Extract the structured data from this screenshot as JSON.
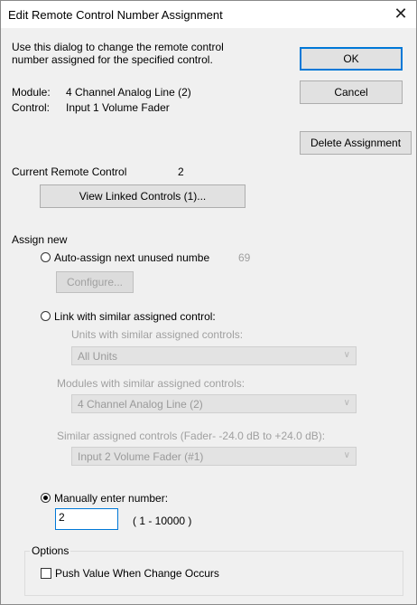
{
  "window": {
    "title": "Edit Remote Control Number Assignment",
    "close_glyph": "✕"
  },
  "intro": {
    "line1": "Use this dialog to change the remote control",
    "line2": "number assigned for the specified control."
  },
  "module": {
    "label": "Module:",
    "value": "4 Channel Analog Line (2)"
  },
  "control": {
    "label": "Control:",
    "value": "Input 1 Volume Fader"
  },
  "buttons": {
    "ok": "OK",
    "cancel": "Cancel",
    "delete": "Delete Assignment",
    "view_linked": "View Linked Controls (1)...",
    "configure": "Configure..."
  },
  "current": {
    "label": "Current Remote Control",
    "value": "2"
  },
  "assign": {
    "heading": "Assign new",
    "auto": {
      "label": "Auto-assign next unused numbe",
      "next": "69"
    },
    "link": {
      "label": "Link with similar assigned control:",
      "units_label": "Units with similar assigned controls:",
      "units_value": "All Units",
      "modules_label": "Modules with similar assigned controls:",
      "modules_value": "4 Channel Analog Line (2)",
      "similar_label": "Similar assigned controls (Fader- -24.0 dB to +24.0 dB):",
      "similar_value": "Input 2 Volume Fader (#1)"
    },
    "manual": {
      "label": "Manually enter number:",
      "value": "2",
      "range": "( 1 - 10000 )"
    }
  },
  "options": {
    "heading": "Options",
    "push_label": "Push Value When Change Occurs"
  }
}
